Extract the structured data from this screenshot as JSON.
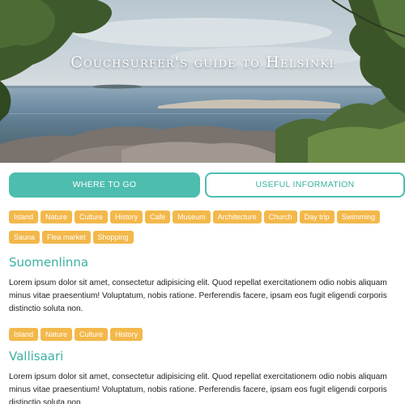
{
  "hero": {
    "title": "Couchsurfer's guide to Helsinki"
  },
  "tabs": {
    "where_to_go": "WHERE TO GO",
    "useful_information": "USEFUL INFORMATION"
  },
  "filter_tags": [
    "Island",
    "Nature",
    "Culture",
    "History",
    "Cafe",
    "Museum",
    "Architecture",
    "Church",
    "Day trip",
    "Swimming",
    "Sauna",
    "Flea market",
    "Shopping"
  ],
  "entries": [
    {
      "title": "Suomenlinna",
      "text": "Lorem ipsum dolor sit amet, consectetur adipisicing elit. Quod repellat exercitationem odio nobis aliquam minus vitae praesentium! Voluptatum, nobis ratione. Perferendis facere, ipsam eos fugit eligendi corporis distinctio soluta non.",
      "tags": [
        "Island",
        "Nature",
        "Culture",
        "History"
      ]
    },
    {
      "title": "Vallisaari",
      "text": "Lorem ipsum dolor sit amet, consectetur adipisicing elit. Quod repellat exercitationem odio nobis aliquam minus vitae praesentium! Voluptatum, nobis ratione. Perferendis facere, ipsam eos fugit eligendi corporis distinctio soluta non."
    }
  ],
  "colors": {
    "accent": "#4dbdaf",
    "tag": "#f3b84a",
    "title": "#3bb0a3"
  }
}
